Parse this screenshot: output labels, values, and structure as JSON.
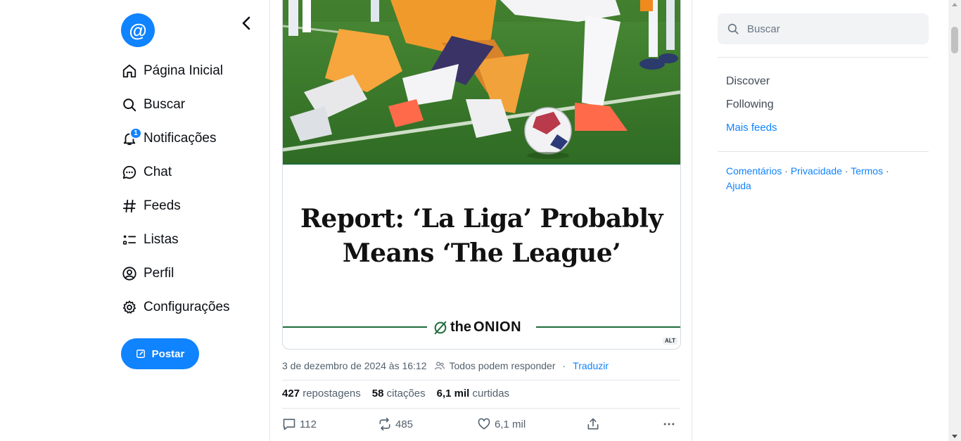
{
  "sidebar": {
    "logo_glyph": "@",
    "nav": [
      {
        "label": "Página Inicial",
        "icon": "home-icon"
      },
      {
        "label": "Buscar",
        "icon": "search-icon"
      },
      {
        "label": "Notificações",
        "icon": "bell-icon",
        "badge": "1"
      },
      {
        "label": "Chat",
        "icon": "chat-icon"
      },
      {
        "label": "Feeds",
        "icon": "hash-icon"
      },
      {
        "label": "Listas",
        "icon": "list-icon"
      },
      {
        "label": "Perfil",
        "icon": "profile-icon"
      },
      {
        "label": "Configurações",
        "icon": "gear-icon"
      }
    ],
    "post_label": "Postar"
  },
  "post": {
    "headline_line1": "Report: ‘La Liga’ Probably",
    "headline_line2": "Means ‘The League’",
    "source_small": "the",
    "source_big": "ONION",
    "alt_label": "ALT",
    "timestamp": "3 de dezembro de 2024 às 16:12",
    "reply_setting": "Todos podem responder",
    "separator": "·",
    "translate": "Traduzir",
    "stats": {
      "reposts_count": "427",
      "reposts_label": "repostagens",
      "quotes_count": "58",
      "quotes_label": "citações",
      "likes_count": "6,1 mil",
      "likes_label": "curtidas"
    },
    "actions": {
      "replies": "112",
      "reposts": "485",
      "likes": "6,1 mil"
    }
  },
  "right": {
    "search_placeholder": "Buscar",
    "feeds": [
      "Discover",
      "Following"
    ],
    "more_feeds": "Mais feeds",
    "footer": [
      "Comentários",
      "Privacidade",
      "Termos",
      "Ajuda"
    ],
    "footer_sep": " · "
  },
  "colors": {
    "accent": "#1083fe",
    "onion_green": "#1d6b3a"
  }
}
